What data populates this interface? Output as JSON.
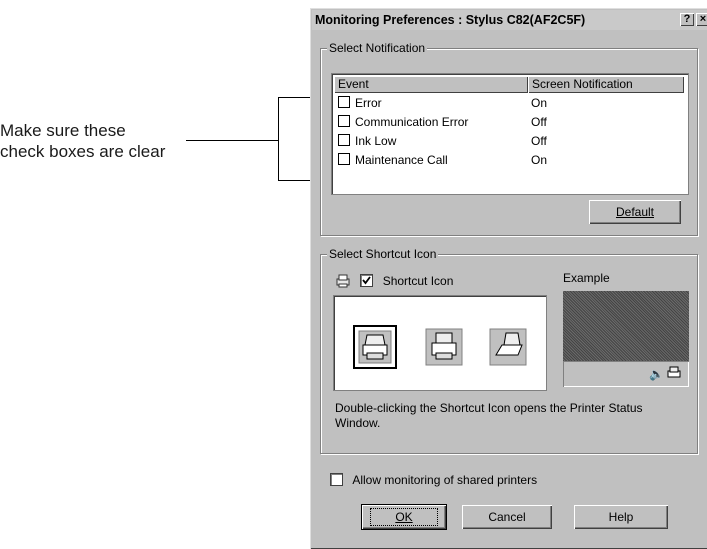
{
  "annotation": {
    "line1": "Make sure these",
    "line2": "check boxes are clear"
  },
  "dialog": {
    "title": "Monitoring Preferences : Stylus C82(AF2C5F)",
    "help_btn": "?",
    "close_btn": "×",
    "notification": {
      "group_label": "Select Notification",
      "columns": [
        "Event",
        "Screen Notification"
      ],
      "rows": [
        {
          "event": "Error",
          "value": "On"
        },
        {
          "event": "Communication Error",
          "value": "Off"
        },
        {
          "event": "Ink Low",
          "value": "Off"
        },
        {
          "event": "Maintenance Call",
          "value": "On"
        }
      ],
      "default_button": "Default"
    },
    "shortcut": {
      "group_label": "Select Shortcut Icon",
      "checkbox_label": "Shortcut Icon",
      "checkbox_checked": true,
      "example_label": "Example",
      "description": "Double-clicking the Shortcut Icon opens the Printer Status Window."
    },
    "shared": {
      "checkbox_label": "Allow monitoring of shared printers",
      "checked": false
    },
    "buttons": {
      "ok": "OK",
      "cancel": "Cancel",
      "help": "Help"
    }
  }
}
